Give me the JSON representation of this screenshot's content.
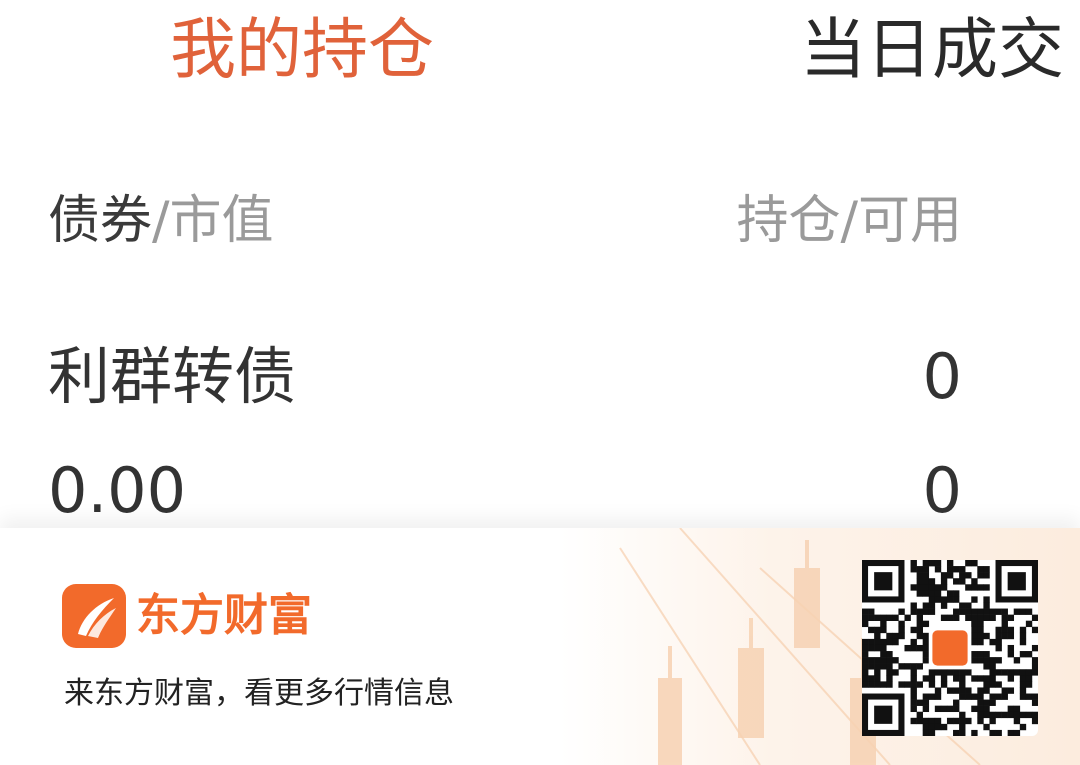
{
  "tabs": {
    "holdings": "我的持仓",
    "today_trades": "当日成交"
  },
  "header": {
    "bond": "债券",
    "market_value": "/市值",
    "holding_available": "持仓/可用"
  },
  "position": {
    "name": "利群转债",
    "market_value": "0.00",
    "holding": "0",
    "available": "0"
  },
  "banner": {
    "brand": "东方财富",
    "slogan": "来东方财富，看更多行情信息",
    "logo_icon": "eastmoney-logo-icon",
    "qr_icon": "qr-code-icon"
  },
  "colors": {
    "accent": "#e0623a",
    "brand": "#f26a2b"
  }
}
